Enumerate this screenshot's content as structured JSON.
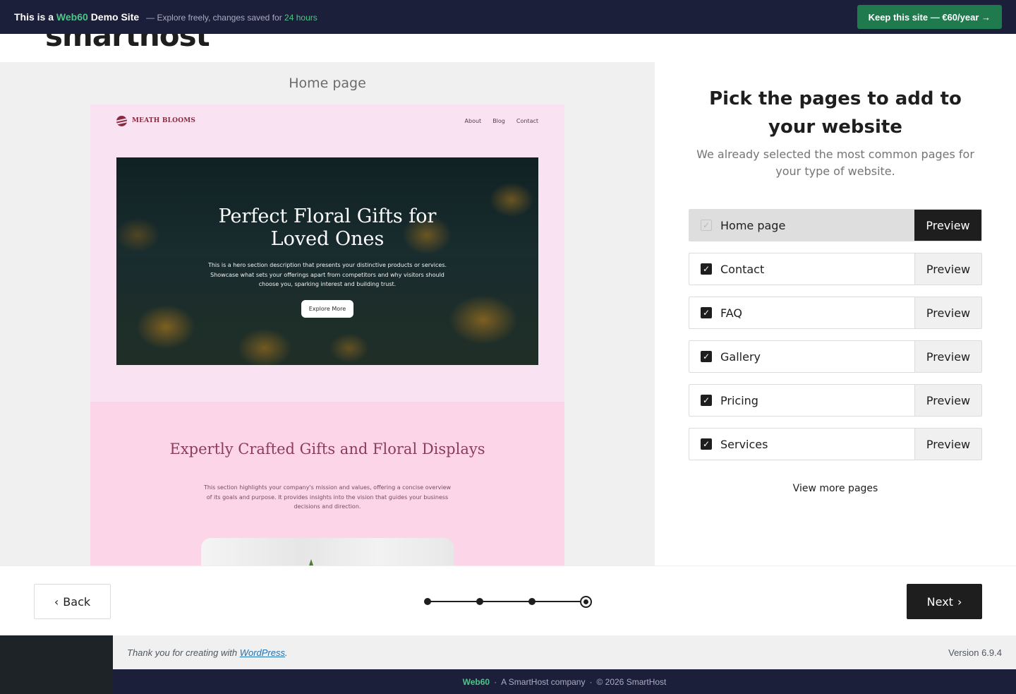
{
  "demo_bar": {
    "prefix": "This is a",
    "brand": "Web60",
    "suffix": "Demo Site",
    "note_prefix": "— Explore freely, changes saved for",
    "note_highlight": "24 hours",
    "keep_button": "Keep this site — €60/year →"
  },
  "logo": {
    "text": "smarthost"
  },
  "preview": {
    "title": "Home page",
    "site": {
      "brand": "MEATH BLOOMS",
      "nav": [
        "About",
        "Blog",
        "Contact"
      ],
      "hero_title": "Perfect Floral Gifts for Loved Ones",
      "hero_desc": "This is a hero section description that presents your distinctive products or services. Showcase what sets your offerings apart from competitors and why visitors should choose you, sparking interest and building trust.",
      "hero_button": "Explore More",
      "sec2_title": "Expertly Crafted Gifts and Floral Displays",
      "sec2_desc": "This section highlights your company's mission and values, offering a concise overview of its goals and purpose. It provides insights into the vision that guides your business decisions and direction."
    }
  },
  "panel": {
    "title": "Pick the pages to add to your website",
    "subtitle": "We already selected the most common pages for your type of website.",
    "pages": [
      {
        "label": "Home page",
        "preview": "Preview",
        "checked": true,
        "active": true
      },
      {
        "label": "Contact",
        "preview": "Preview",
        "checked": true,
        "active": false
      },
      {
        "label": "FAQ",
        "preview": "Preview",
        "checked": true,
        "active": false
      },
      {
        "label": "Gallery",
        "preview": "Preview",
        "checked": true,
        "active": false
      },
      {
        "label": "Pricing",
        "preview": "Preview",
        "checked": true,
        "active": false
      },
      {
        "label": "Services",
        "preview": "Preview",
        "checked": true,
        "active": false
      }
    ],
    "view_more": "View more pages"
  },
  "footer_nav": {
    "back": "Back",
    "back_icon": "chevron-left-icon",
    "next": "Next",
    "next_icon": "chevron-right-icon",
    "steps_total": 4,
    "step_current": 4
  },
  "wp_footer": {
    "thanks_prefix": "Thank you for creating with",
    "thanks_link": "WordPress",
    "thanks_suffix": ".",
    "version": "Version 6.9.4"
  },
  "bottom_bar": {
    "brand": "Web60",
    "sep": "·",
    "company": "A SmartHost company",
    "copyright": "© 2026 SmartHost"
  },
  "colors": {
    "banner_bg": "#1c1f3a",
    "brand_green": "#4fc38a",
    "keep_button": "#1f7a4d",
    "dark": "#1e1e1e",
    "site_pink": "#f9e3f2",
    "site_pink2": "#fcd6e8"
  }
}
